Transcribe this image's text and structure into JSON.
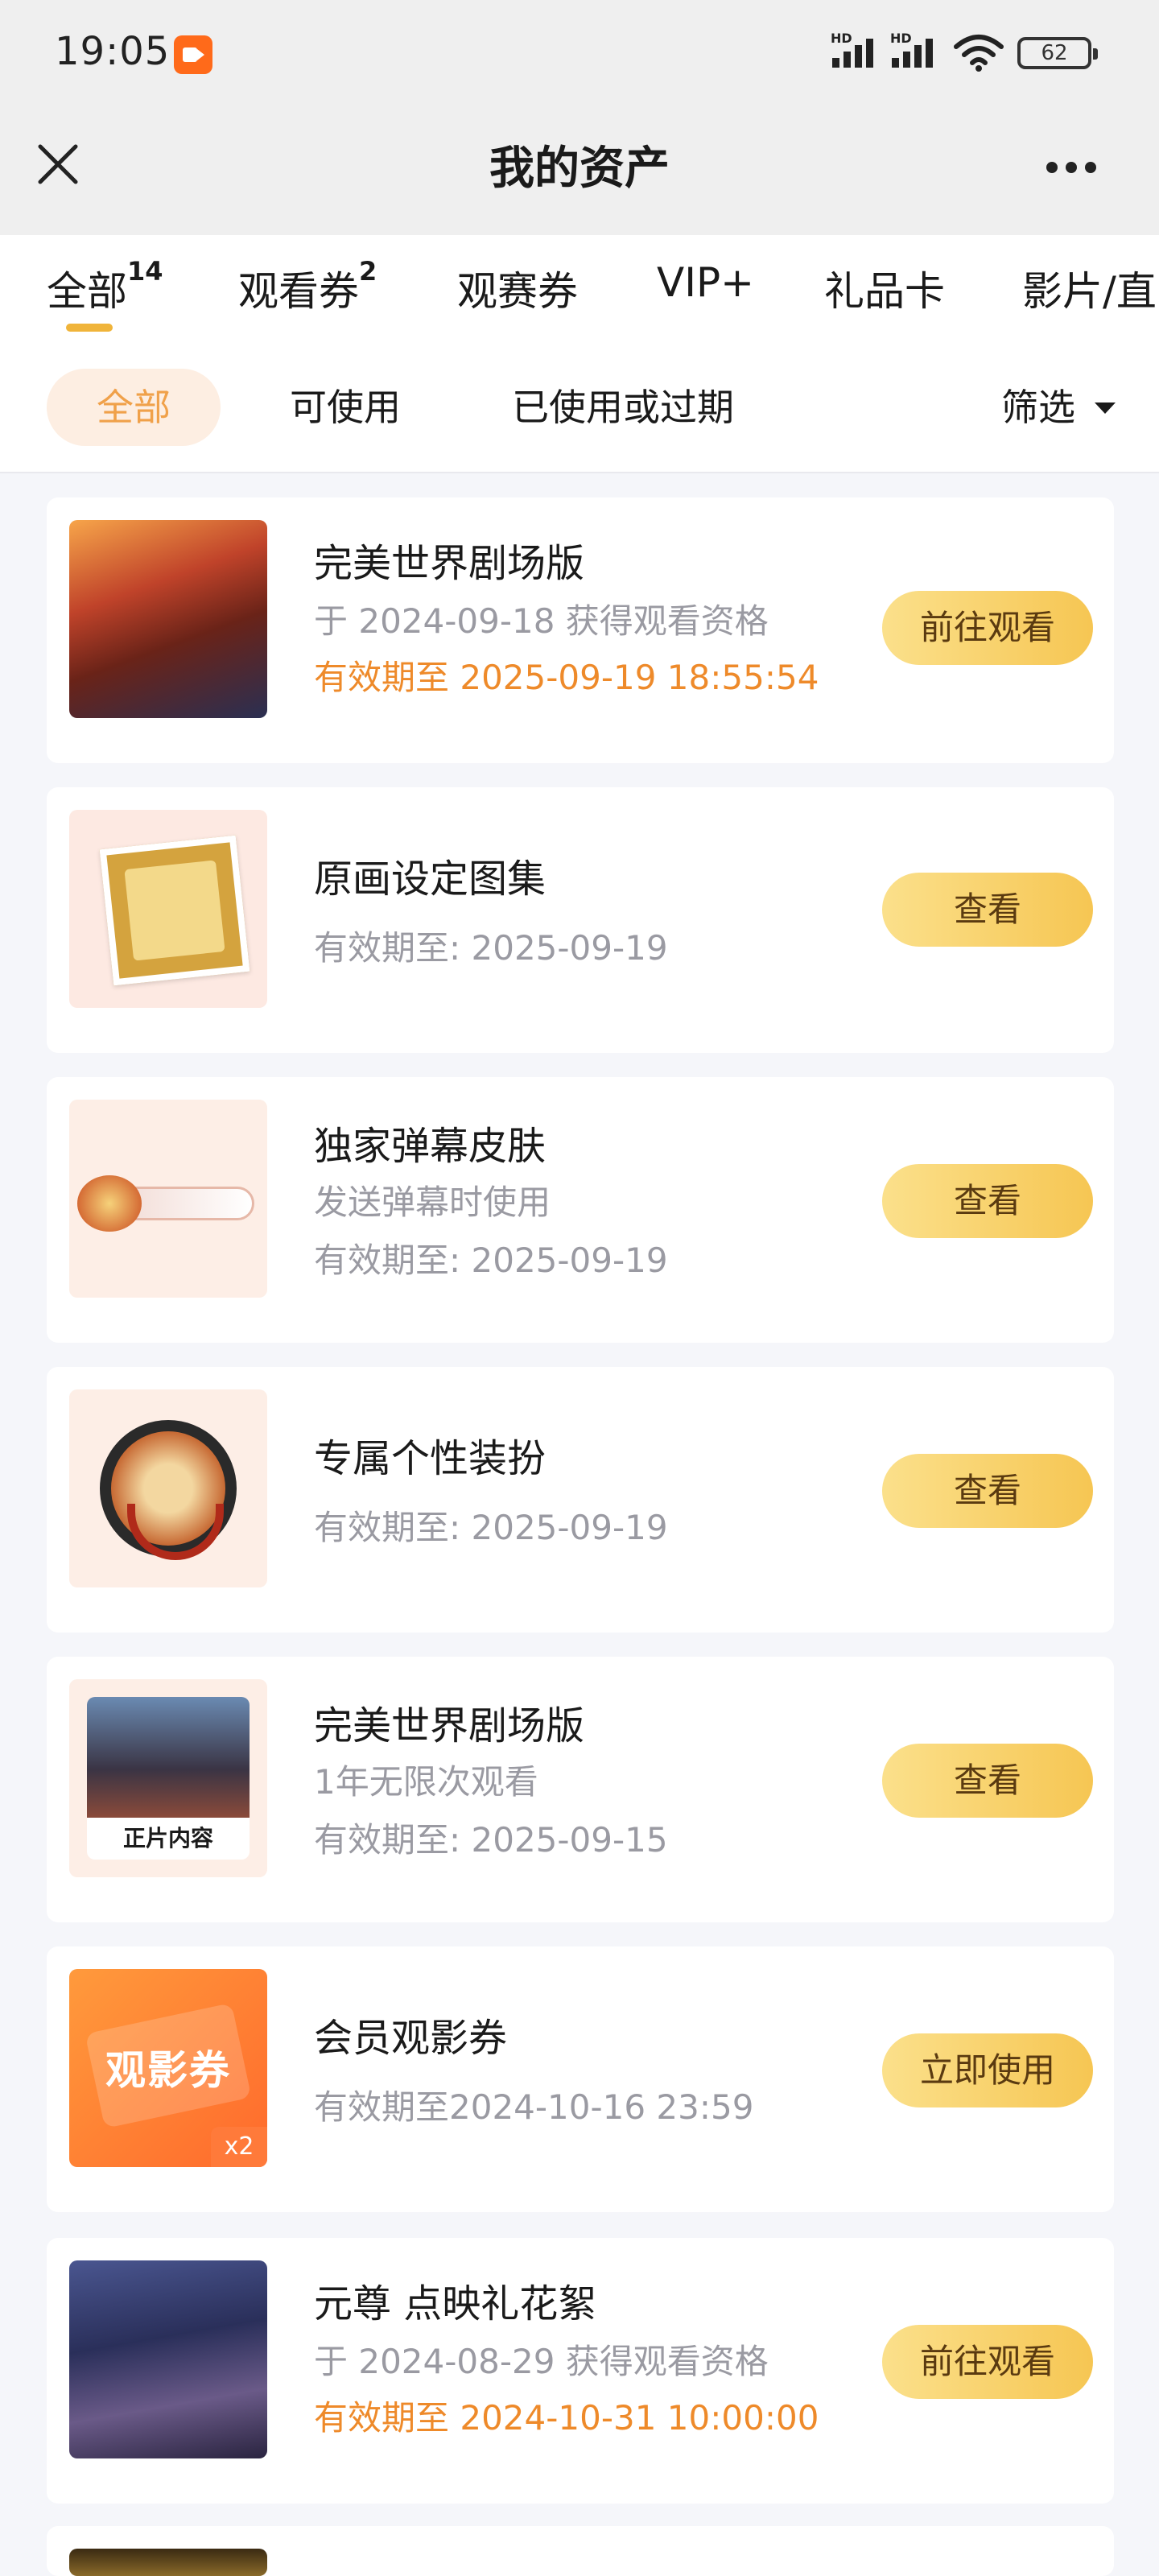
{
  "status_bar": {
    "time": "19:05",
    "battery": "62",
    "signal_label_1": "HD",
    "signal_label_2": "HD"
  },
  "header": {
    "title": "我的资产"
  },
  "tabs": [
    {
      "label": "全部",
      "count": "14"
    },
    {
      "label": "观看券",
      "count": "2"
    },
    {
      "label": "观赛券",
      "count": ""
    },
    {
      "label": "VIP+",
      "count": ""
    },
    {
      "label": "礼品卡",
      "count": ""
    },
    {
      "label": "影片/直",
      "count": ""
    }
  ],
  "filters": {
    "items": [
      "全部",
      "可使用",
      "已使用或过期"
    ],
    "sort_label": "筛选"
  },
  "cards": [
    {
      "title": "完美世界剧场版",
      "sub": "于 2024-09-18 获得观看资格",
      "expiry": "有效期至 2025-09-19 18:55:54",
      "button": "前往观看"
    },
    {
      "title": "原画设定图集",
      "sub": "",
      "expiry": "有效期至: 2025-09-19",
      "button": "查看"
    },
    {
      "title": "独家弹幕皮肤",
      "sub": "发送弹幕时使用",
      "expiry": "有效期至: 2025-09-19",
      "button": "查看"
    },
    {
      "title": "专属个性装扮",
      "sub": "",
      "expiry": "有效期至: 2025-09-19",
      "button": "查看"
    },
    {
      "title": "完美世界剧场版",
      "sub": "1年无限次观看",
      "expiry": "有效期至: 2025-09-15",
      "button": "查看",
      "thumb_label": "正片内容"
    },
    {
      "title": "会员观影券",
      "sub": "",
      "expiry": "有效期至2024-10-16 23:59",
      "button": "立即使用",
      "thumb_label": "观影券",
      "thumb_count": "x2"
    },
    {
      "title": "元尊 点映礼花絮",
      "sub": "于 2024-08-29 获得观看资格",
      "expiry": "有效期至 2024-10-31 10:00:00",
      "button": "前往观看"
    }
  ],
  "colors": {
    "accent": "#f6c653",
    "expiry_orange": "#ee8a2a",
    "muted_text": "#9a9aa2"
  }
}
